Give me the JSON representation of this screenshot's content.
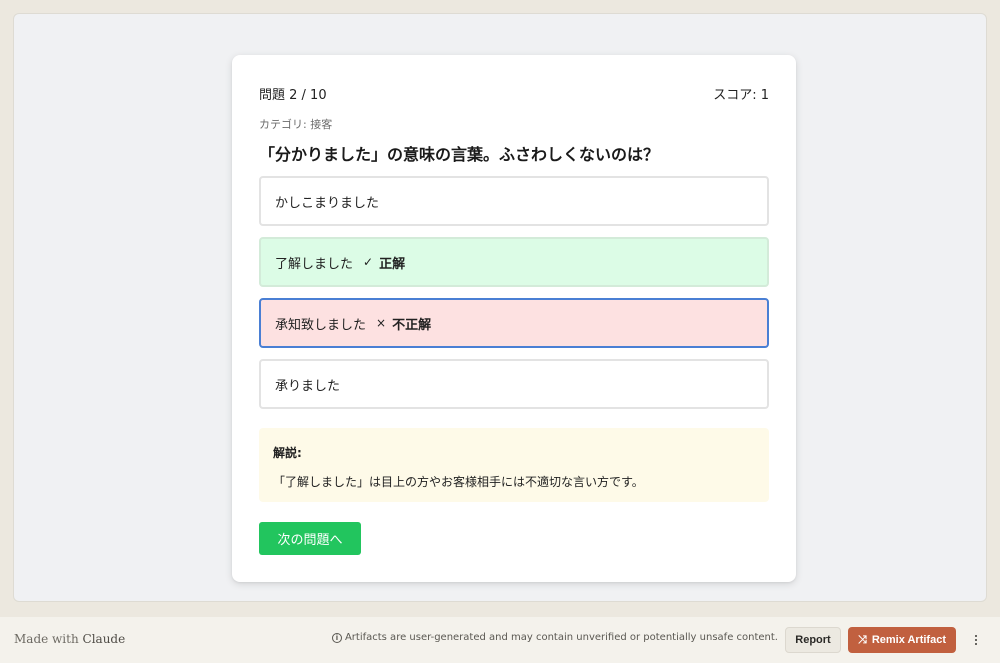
{
  "quiz": {
    "progress_label": "問題 2 / 10",
    "score_label": "スコア: 1",
    "category_label": "カテゴリ: 接客",
    "question": "「分かりました」の意味の言葉。ふさわしくないのは？",
    "options": [
      {
        "text": "かしこまりました",
        "state": "neutral",
        "mark": "",
        "verdict": ""
      },
      {
        "text": "了解しました",
        "state": "correct",
        "mark": "✓",
        "verdict": "正解"
      },
      {
        "text": "承知致しました",
        "state": "wrong",
        "mark": "×",
        "verdict": "不正解"
      },
      {
        "text": "承りました",
        "state": "neutral",
        "mark": "",
        "verdict": ""
      }
    ],
    "explanation_title": "解説:",
    "explanation_text": "「了解しました」は目上の方やお客様相手には不適切な言い方です。",
    "next_button": "次の問題へ"
  },
  "footer": {
    "made_with": "Made with",
    "brand": "Claude",
    "info_icon": "i",
    "disclaimer": "Artifacts are user-generated and may contain unverified or potentially unsafe content.",
    "report_button": "Report",
    "remix_icon": "⤨",
    "remix_button": "Remix Artifact"
  },
  "colors": {
    "correct_bg": "#dcfce6",
    "wrong_bg": "#fde1e1",
    "selected_border": "#4a7fd4",
    "next_button_bg": "#22c55e",
    "remix_bg": "#c1603f",
    "explanation_bg": "#fefae8"
  }
}
